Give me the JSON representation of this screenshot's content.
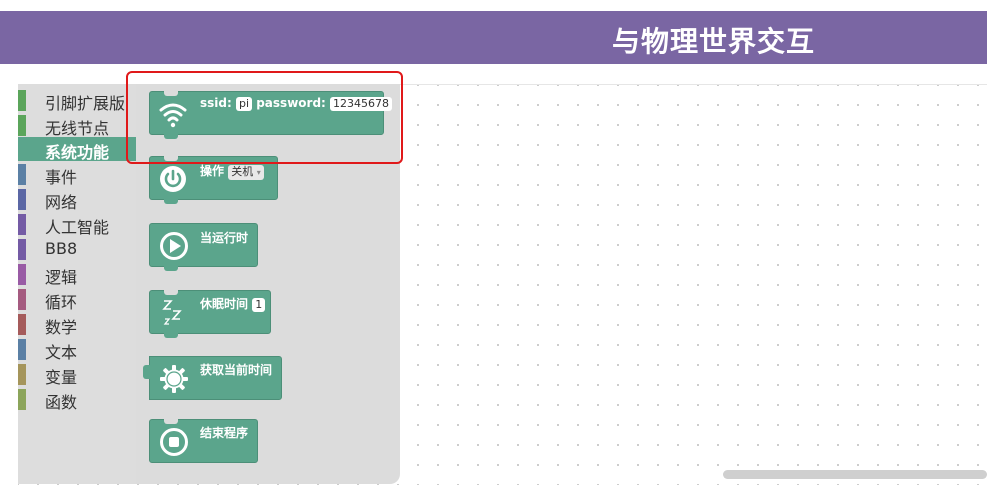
{
  "banner": {
    "title": "与物理世界交互"
  },
  "toolbox": {
    "categories": [
      {
        "label": "引脚扩展版",
        "color": "#5ba55b"
      },
      {
        "label": "无线节点",
        "color": "#5ba55b"
      },
      {
        "label": "系统功能",
        "color": "#5ba58c",
        "selected": true
      },
      {
        "label": "事件",
        "color": "#5b80a5"
      },
      {
        "label": "网络",
        "color": "#5b67a5"
      },
      {
        "label": "人工智能",
        "color": "#745ba5"
      },
      {
        "label": "BB8",
        "color": "#745ba5"
      },
      {
        "label": "逻辑",
        "color": "#995ba5"
      },
      {
        "label": "循环",
        "color": "#a55b80"
      },
      {
        "label": "数学",
        "color": "#a55b5b"
      },
      {
        "label": "文本",
        "color": "#5b80a5"
      },
      {
        "label": "变量",
        "color": "#a5955b"
      },
      {
        "label": "函数",
        "color": "#8ca55b"
      }
    ]
  },
  "blocks": {
    "wifi": {
      "ssid_label": "ssid:",
      "ssid_value": "pi",
      "password_label": "password:",
      "password_value": "12345678",
      "icon": "wifi-icon"
    },
    "power": {
      "label": "操作",
      "value": "关机",
      "icon": "power-icon"
    },
    "run": {
      "label": "当运行时",
      "icon": "play-icon"
    },
    "sleep": {
      "label": "休眠时间",
      "value": "1",
      "icon": "sleep-icon"
    },
    "time": {
      "label": "获取当前时间",
      "icon": "gear-icon"
    },
    "end": {
      "label": "结束程序",
      "icon": "stop-icon"
    }
  },
  "colors": {
    "accent": "#7a66a3",
    "block": "#5ba58c",
    "highlight": "#e0191a"
  }
}
